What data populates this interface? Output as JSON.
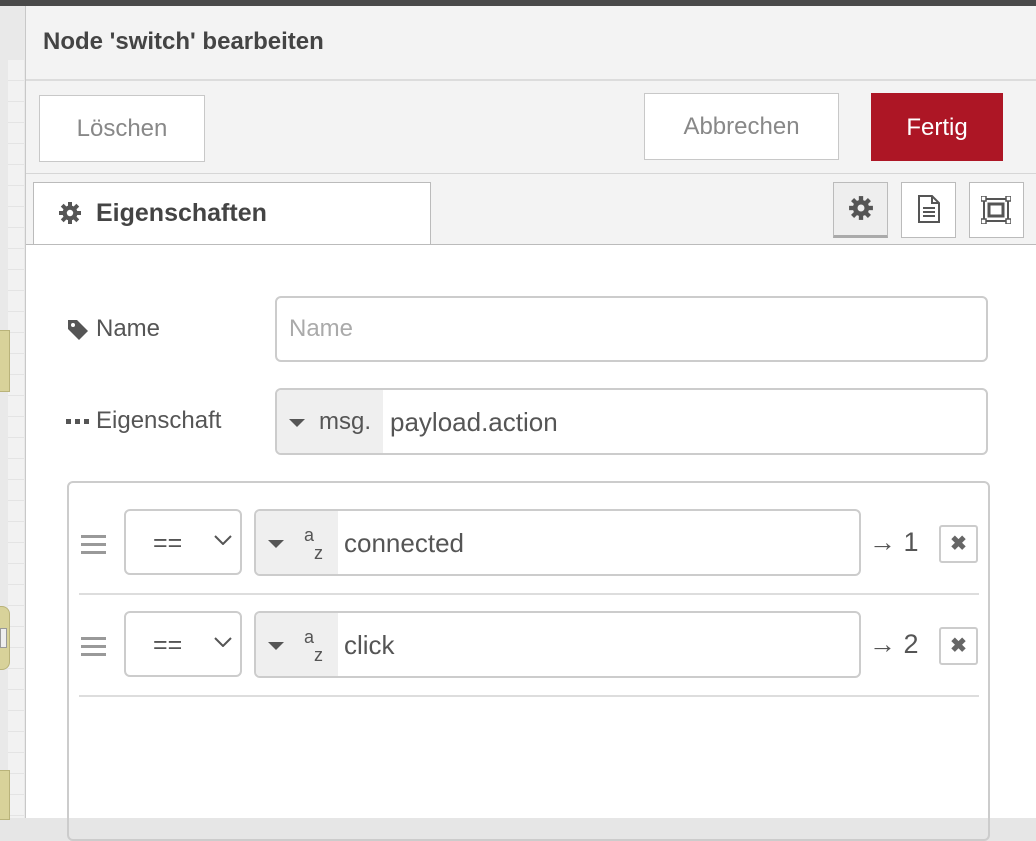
{
  "dialog": {
    "title": "Node 'switch' bearbeiten",
    "delete_label": "Löschen",
    "cancel_label": "Abbrechen",
    "done_label": "Fertig",
    "done_color": "#ad1625"
  },
  "tabs": {
    "properties_label": "Eigenschaften",
    "properties_icon": "gear-icon",
    "side_buttons": [
      "gear-icon",
      "document-icon",
      "appearance-icon"
    ]
  },
  "form": {
    "name": {
      "label": "Name",
      "icon": "tag-icon",
      "value": "",
      "placeholder": "Name"
    },
    "property": {
      "label": "Eigenschaft",
      "icon": "ellipsis-icon",
      "prefix": "msg.",
      "value": "payload.action"
    }
  },
  "rules": [
    {
      "operator": "==",
      "type_top": "a",
      "type_bottom": "z",
      "value": "connected",
      "output": "→ 1",
      "delete_icon": "close-icon"
    },
    {
      "operator": "==",
      "type_top": "a",
      "type_bottom": "z",
      "value": "click",
      "output": "→ 2",
      "delete_icon": "close-icon"
    }
  ]
}
